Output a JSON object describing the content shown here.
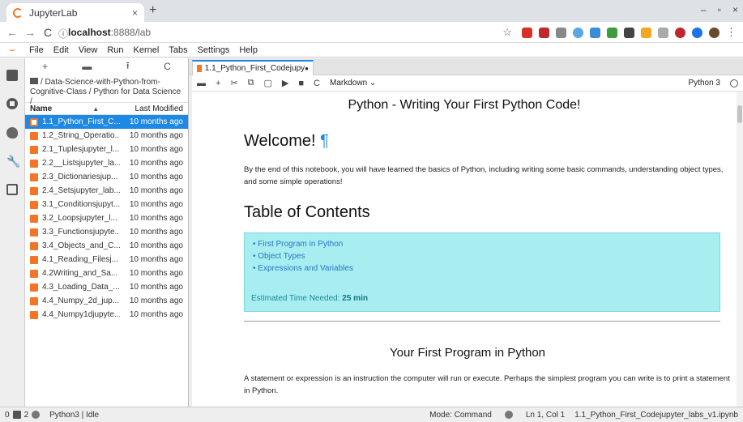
{
  "browser": {
    "tab_title": "JupyterLab",
    "tab_close": "×",
    "new_tab": "+",
    "url_host": "localhost",
    "url_port_path": ":8888/lab",
    "window_min": "–",
    "window_max": "▫",
    "window_close": "×",
    "back": "←",
    "forward": "→",
    "reload": "C",
    "info": "ⓘ",
    "star": "☆",
    "menu_dots": "⋮"
  },
  "menubar": {
    "items": [
      "File",
      "Edit",
      "View",
      "Run",
      "Kernel",
      "Tabs",
      "Settings",
      "Help"
    ]
  },
  "filebrowser": {
    "toolbar": [
      "+",
      "▬",
      "⭱",
      "C"
    ],
    "breadcrumb": "/ Data-Science-with-Python-from-Cognitive-Class / Python for Data Science /",
    "col_name": "Name",
    "col_arrow": "▲",
    "col_modified": "Last Modified",
    "files": [
      {
        "name": "1.1_Python_First_C...",
        "modified": "10 months ago"
      },
      {
        "name": "1.2_String_Operatio...",
        "modified": "10 months ago"
      },
      {
        "name": "2.1_Tuplesjupyter_l...",
        "modified": "10 months ago"
      },
      {
        "name": "2.2__Listsjupyter_la...",
        "modified": "10 months ago"
      },
      {
        "name": "2.3_Dictionariesjup...",
        "modified": "10 months ago"
      },
      {
        "name": "2.4_Setsjupyter_lab...",
        "modified": "10 months ago"
      },
      {
        "name": "3.1_Conditionsjupyt...",
        "modified": "10 months ago"
      },
      {
        "name": "3.2_Loopsjupyter_l...",
        "modified": "10 months ago"
      },
      {
        "name": "3.3_Functionsjupyte...",
        "modified": "10 months ago"
      },
      {
        "name": "3.4_Objects_and_C...",
        "modified": "10 months ago"
      },
      {
        "name": "4.1_Reading_Filesj...",
        "modified": "10 months ago"
      },
      {
        "name": "4.2Writing_and_Sa...",
        "modified": "10 months ago"
      },
      {
        "name": "4.3_Loading_Data_...",
        "modified": "10 months ago"
      },
      {
        "name": "4.4_Numpy_2d_jup...",
        "modified": "10 months ago"
      },
      {
        "name": "4.4_Numpy1djupyte...",
        "modified": "10 months ago"
      }
    ]
  },
  "notebook": {
    "tab_title": "1.1_Python_First_Codejupy",
    "tab_dirty": "●",
    "toolbar": [
      "▬",
      "+",
      "✂",
      "⧉",
      "▢",
      "▶",
      "■",
      "C"
    ],
    "cell_type": "Markdown ⌄",
    "kernel": "Python 3",
    "title": "Python - Writing Your First Python Code!",
    "welcome": "Welcome!",
    "pilcrow": "¶",
    "intro": "By the end of this notebook, you will have learned the basics of Python, including writing some basic commands, understanding object types, and some simple operations!",
    "toc_heading": "Table of Contents",
    "toc_items": [
      "First Program in Python",
      "Object Types",
      "Expressions and Variables"
    ],
    "est_label": "Estimated Time Needed:",
    "est_value": "25 min",
    "section_heading": "Your First Program in Python",
    "section_text": "A statement or expression is an instruction the computer will run or execute. Perhaps the simplest program you can write is to print a statement in Python."
  },
  "statusbar": {
    "num_a": "0",
    "num_b": "2",
    "kernel_status": "Python3 | Idle",
    "mode": "Mode: Command",
    "position": "Ln 1, Col 1",
    "filename": "1.1_Python_First_Codejupyter_labs_v1.ipynb"
  },
  "colors": {
    "accent": "#1e88e5",
    "jupyter_orange": "#f37626",
    "toc_bg": "#a8eef1"
  }
}
